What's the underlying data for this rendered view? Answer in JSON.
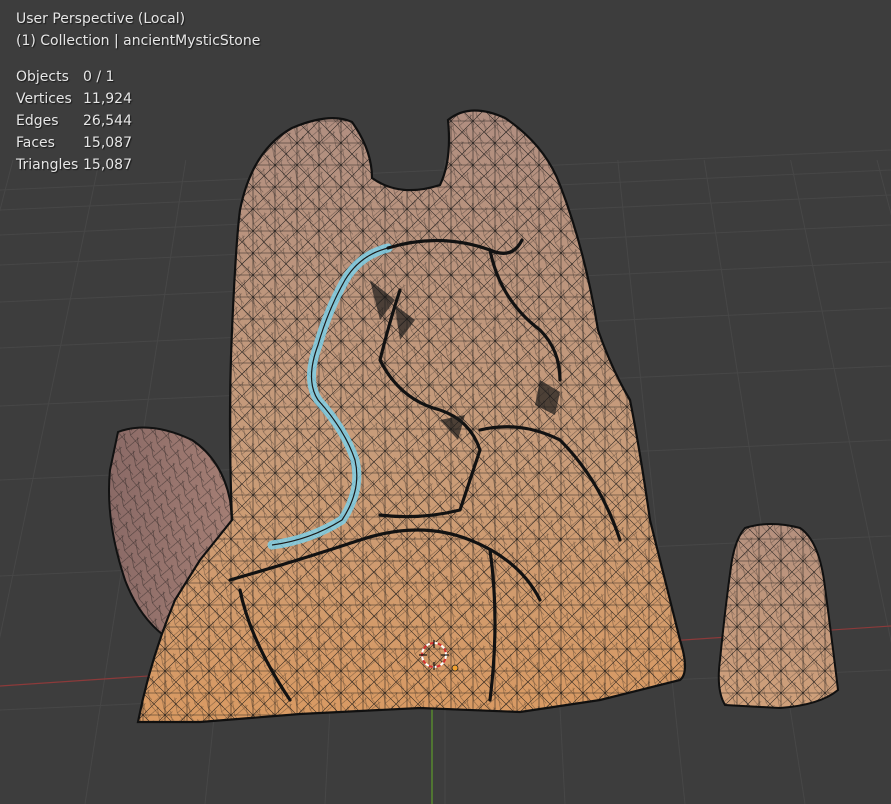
{
  "viewport": {
    "view_name": "User Perspective (Local)",
    "collection_line": "(1) Collection | ancientMysticStone",
    "background_color": "#3d3d3d",
    "grid_color": "#474747",
    "x_axis_color": "#8c3a3a",
    "z_axis_color": "#5e9b2c",
    "mesh_color": "#c29677",
    "wire_color": "#0d0d0d",
    "crack_glow_color": "#7fd0e8",
    "cursor_icon": "3d-cursor-icon",
    "origin_color": "#f0a030"
  },
  "stats": [
    {
      "label": "Objects",
      "value": "0 / 1"
    },
    {
      "label": "Vertices",
      "value": "11,924"
    },
    {
      "label": "Edges",
      "value": "26,544"
    },
    {
      "label": "Faces",
      "value": "15,087"
    },
    {
      "label": "Triangles",
      "value": "15,087"
    }
  ]
}
